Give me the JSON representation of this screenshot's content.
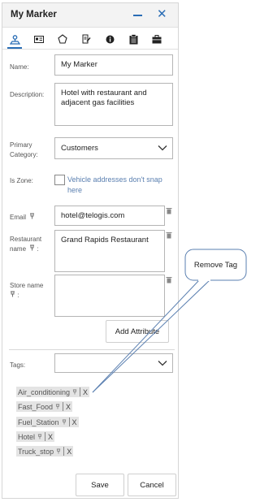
{
  "window": {
    "title": "My Marker"
  },
  "tabs": [
    {
      "icon": "marker-icon",
      "active": true
    },
    {
      "icon": "id-card-icon"
    },
    {
      "icon": "pentagon-icon"
    },
    {
      "icon": "edit-document-icon"
    },
    {
      "icon": "info-icon"
    },
    {
      "icon": "clipboard-icon"
    },
    {
      "icon": "briefcase-icon"
    }
  ],
  "form": {
    "name_label": "Name:",
    "name_value": "My Marker",
    "description_label": "Description:",
    "description_value": "Hotel with restaurant and adjacent gas facilities",
    "category_label_1": "Primary",
    "category_label_2": "Category:",
    "category_value": "Customers",
    "zone_label": "Is Zone:",
    "zone_text": "Vehicle addresses don't snap here",
    "email_label": "Email",
    "email_value": "hotel@telogis.com",
    "restaurant_label_1": "Restaurant",
    "restaurant_label_2": "name",
    "restaurant_value": "Grand Rapids Restaurant",
    "store_label_1": "Store name",
    "store_value": "",
    "add_attribute_label": "Add Attribute",
    "tags_label": "Tags:",
    "tags_value": ""
  },
  "tags": [
    {
      "label": "Air_conditioning",
      "remove": "X"
    },
    {
      "label": "Fast_Food",
      "remove": "X"
    },
    {
      "label": "Fuel_Station",
      "remove": "X"
    },
    {
      "label": "Hotel",
      "remove": "X"
    },
    {
      "label": "Truck_stop",
      "remove": "X"
    }
  ],
  "footer": {
    "save_label": "Save",
    "cancel_label": "Cancel"
  },
  "callout": {
    "text": "Remove Tag"
  },
  "colors": {
    "accent": "#2a6db5",
    "link": "#5a7fb0",
    "tag_bg": "#e4e4e4"
  }
}
